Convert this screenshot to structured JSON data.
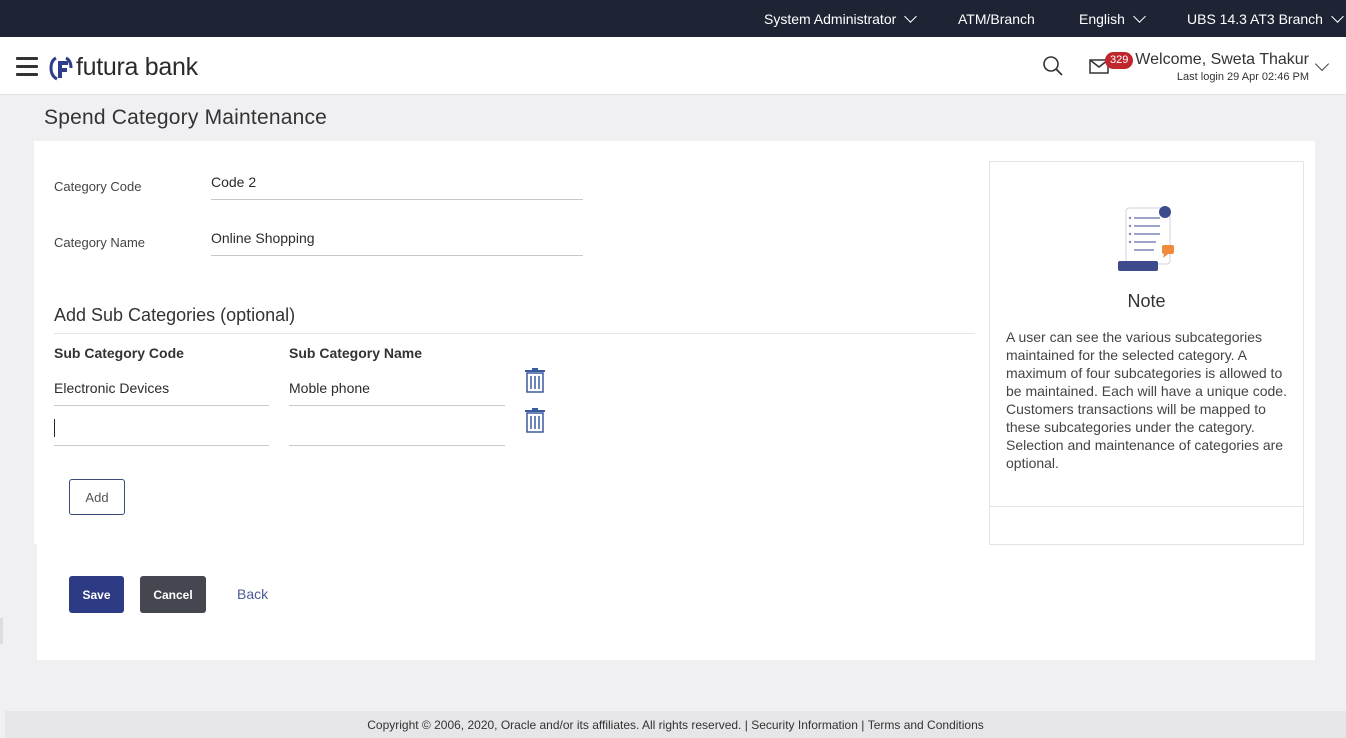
{
  "topbar": {
    "role": "System Administrator",
    "location": "ATM/Branch",
    "language": "English",
    "entity": "UBS 14.3 AT3 Branch"
  },
  "header": {
    "brand": "futura bank",
    "mail_count": "329",
    "welcome": "Welcome, Sweta Thakur",
    "last_login": "Last login 29 Apr 02:46 PM"
  },
  "page": {
    "title": "Spend Category Maintenance"
  },
  "form": {
    "category_code_label": "Category Code",
    "category_code_value": "Code 2",
    "category_name_label": "Category Name",
    "category_name_value": "Online Shopping",
    "subcategory_section_title": "Add Sub Categories (optional)",
    "col_code": "Sub Category Code",
    "col_name": "Sub Category Name",
    "rows": [
      {
        "code": "Electronic Devices",
        "name": "Moble phone"
      },
      {
        "code": "",
        "name": ""
      }
    ],
    "add_label": "Add"
  },
  "actions": {
    "save": "Save",
    "cancel": "Cancel",
    "back": "Back"
  },
  "note": {
    "title": "Note",
    "paragraphs": [
      "A user can see the various subcategories maintained for the selected category. A maximum of four subcategories is allowed to be maintained. Each will have a unique code.",
      "Customers transactions will be mapped to these subcategories under the category.",
      "Selection and maintenance of categories are optional."
    ]
  },
  "footer": {
    "copyright": "Copyright © 2006, 2020, Oracle and/or its affiliates. All rights reserved.",
    "separator": " | ",
    "security": "Security Information",
    "terms": "Terms and Conditions"
  },
  "colors": {
    "topbar": "#1e2433",
    "primary": "#2d3a84",
    "secondary": "#444750",
    "badge": "#c0262c",
    "link": "#4b5b94"
  },
  "icons": [
    "hamburger-menu-icon",
    "futura-logo-icon",
    "search-icon",
    "mail-icon",
    "trash-icon",
    "note-document-icon",
    "chevron-down-icon"
  ]
}
